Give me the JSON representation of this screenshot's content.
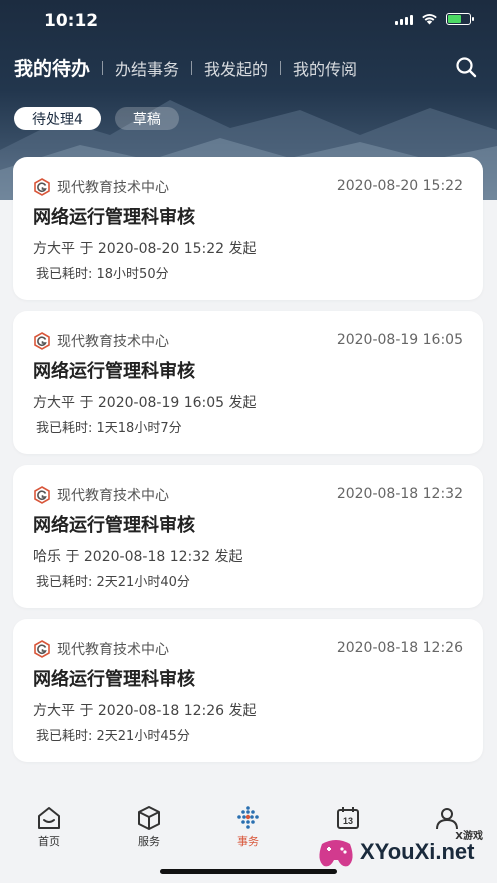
{
  "status_bar": {
    "time": "10:12"
  },
  "nav": {
    "tabs": [
      {
        "label": "我的待办"
      },
      {
        "label": "办结事务"
      },
      {
        "label": "我发起的"
      },
      {
        "label": "我的传阅"
      }
    ]
  },
  "filters": [
    {
      "label": "待处理4"
    },
    {
      "label": "草稿"
    }
  ],
  "tasks": [
    {
      "department": "现代教育技术中心",
      "date": "2020-08-20 15:22",
      "title": "网络运行管理科审核",
      "initiator": "方大平 于 2020-08-20 15:22 发起",
      "elapsed": "我已耗时: 18小时50分"
    },
    {
      "department": "现代教育技术中心",
      "date": "2020-08-19 16:05",
      "title": "网络运行管理科审核",
      "initiator": "方大平 于 2020-08-19 16:05 发起",
      "elapsed": "我已耗时: 1天18小时7分"
    },
    {
      "department": "现代教育技术中心",
      "date": "2020-08-18 12:32",
      "title": "网络运行管理科审核",
      "initiator": "哈乐 于 2020-08-18 12:32 发起",
      "elapsed": "我已耗时: 2天21小时40分"
    },
    {
      "department": "现代教育技术中心",
      "date": "2020-08-18 12:26",
      "title": "网络运行管理科审核",
      "initiator": "方大平 于 2020-08-18 12:26 发起",
      "elapsed": "我已耗时: 2天21小时45分"
    }
  ],
  "bottom_nav": [
    {
      "label": "首页",
      "icon": "home-icon"
    },
    {
      "label": "服务",
      "icon": "cube-icon"
    },
    {
      "label": "事务",
      "icon": "affairs-icon",
      "active": true
    },
    {
      "label": "",
      "icon": "calendar-icon",
      "badge": "13"
    },
    {
      "label": "",
      "icon": "user-icon"
    }
  ],
  "watermark": {
    "text": "XYouXi.net",
    "small": "X游戏"
  },
  "colors": {
    "accent": "#d8563a",
    "header": "#1c2c40",
    "background": "#f2f3f5"
  }
}
